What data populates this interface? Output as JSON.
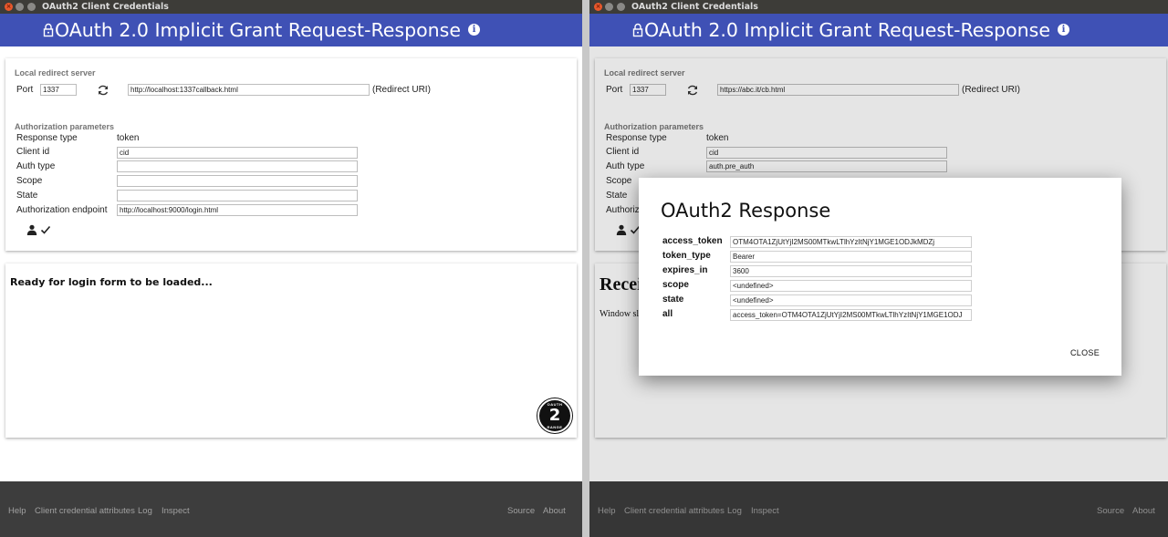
{
  "window_title": "OAuth2 Client Credentials",
  "app_title": "OAuth 2.0 Implicit Grant Request-Response",
  "colors": {
    "appbar": "#3f51b5",
    "titlebar": "#3d3c38",
    "footer": "#3d3d3d"
  },
  "icons": [
    "lock-icon",
    "info-icon",
    "refresh-icon",
    "user-icon",
    "check-icon",
    "oauth2-logo"
  ],
  "local_redirect": {
    "section_label": "Local redirect server",
    "port_label": "Port",
    "redirect_suffix": "(Redirect URI)"
  },
  "auth_params": {
    "section_label": "Authorization parameters",
    "response_type_label": "Response type",
    "response_type_value": "token",
    "client_id_label": "Client id",
    "auth_type_label": "Auth type",
    "scope_label": "Scope",
    "state_label": "State",
    "endpoint_label": "Authorization endpoint"
  },
  "left": {
    "port": "1337",
    "redirect_uri": "http://localhost:1337callback.html",
    "client_id": "cid",
    "auth_type": "",
    "scope": "",
    "state": "",
    "endpoint": "http://localhost:9000/login.html",
    "status_text": "Ready for login form to be loaded...",
    "logo_number": "2",
    "logo_ring_top": "OAUTH",
    "logo_ring_bottom": "RANGE"
  },
  "right": {
    "port": "1337",
    "redirect_uri": "https://abc.it/cb.html",
    "client_id": "cid",
    "auth_type": "auth.pre_auth",
    "endpoint_label_partial": "Authoriz",
    "received_partial": "Recei",
    "received_sub_partial": "Window sl"
  },
  "dialog": {
    "title": "OAuth2 Response",
    "rows": [
      {
        "key": "access_token",
        "value": "OTM4OTA1ZjUtYjI2MS00MTkwLTlhYzItNjY1MGE1ODJkMDZj"
      },
      {
        "key": "token_type",
        "value": "Bearer"
      },
      {
        "key": "expires_in",
        "value": "3600"
      },
      {
        "key": "scope",
        "value": "<undefined>"
      },
      {
        "key": "state",
        "value": "<undefined>"
      },
      {
        "key": "all",
        "value": "access_token=OTM4OTA1ZjUtYjI2MS00MTkwLTlhYzItNjY1MGE1ODJ"
      }
    ],
    "close_label": "CLOSE"
  },
  "footer": {
    "help": "Help",
    "attributes": "Client credential attributes",
    "log": "Log",
    "inspect": "Inspect",
    "source": "Source",
    "about": "About"
  }
}
